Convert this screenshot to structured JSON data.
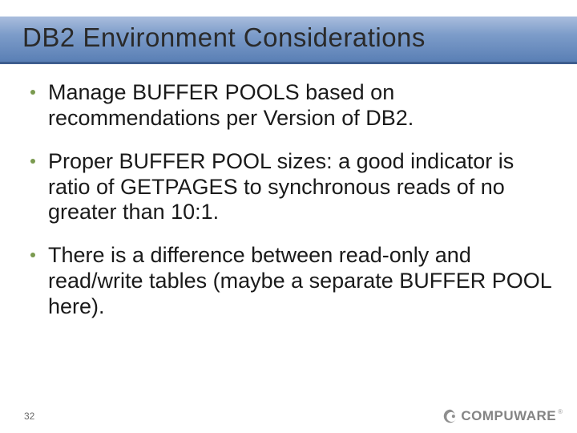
{
  "slide": {
    "title": "DB2 Environment Considerations",
    "bullets": [
      "Manage BUFFER POOLS based on recommendations per Version of DB2.",
      "Proper BUFFER POOL sizes: a good indicator is ratio of GETPAGES to synchronous reads of no greater than 10:1.",
      "There is a difference between read-only and read/write tables (maybe a separate BUFFER POOL here)."
    ],
    "page_number": "32",
    "logo_text": "COMPUWARE",
    "logo_reg": "®"
  }
}
